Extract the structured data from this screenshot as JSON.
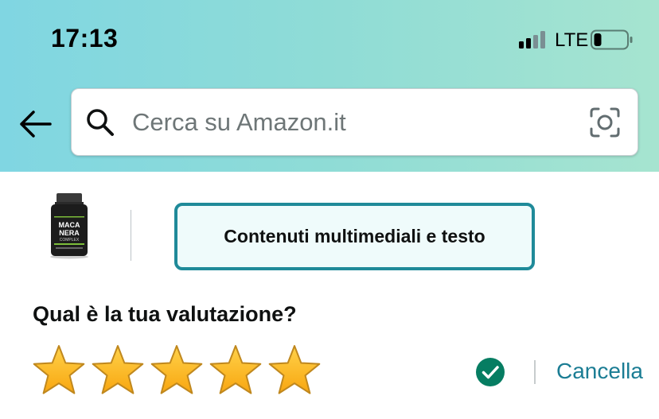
{
  "status_bar": {
    "time": "17:13",
    "network": "LTE"
  },
  "header": {
    "search_placeholder": "Cerca su Amazon.it",
    "background_colors": [
      "#80d6e2",
      "#a6e4d0"
    ]
  },
  "product": {
    "thumbnail_lines": [
      "MACA",
      "NERA",
      "COMPLEX"
    ],
    "media_button_label": "Contenuti multimediali e testo"
  },
  "rating": {
    "question": "Qual è la tua valutazione?",
    "stars_selected": 5,
    "stars_total": 5,
    "cancel_label": "Cancella",
    "accent_color": "#1b7d94",
    "check_color": "#067d62"
  }
}
